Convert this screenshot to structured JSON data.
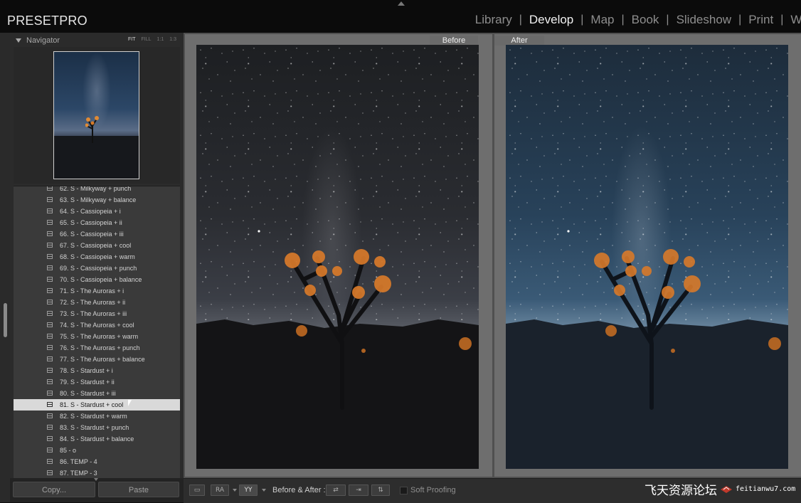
{
  "app": {
    "brand": "PRESETPRO"
  },
  "modules": [
    "Library",
    "Develop",
    "Map",
    "Book",
    "Slideshow",
    "Print",
    "Web"
  ],
  "active_module": "Develop",
  "navigator": {
    "title": "Navigator",
    "zoom_options": [
      "FIT",
      "FILL",
      "1:1",
      "1:3"
    ],
    "active_zoom": "FIT"
  },
  "presets": [
    "62. S - Milkyway + punch",
    "63. S - Milkyway + balance",
    "64. S - Cassiopeia + i",
    "65. S - Cassiopeia + ii",
    "66. S - Cassiopeia + iii",
    "67. S - Cassiopeia + cool",
    "68. S - Cassiopeia + warm",
    "69. S - Cassiopeia + punch",
    "70. S - Cassiopeia + balance",
    "71. S - The Auroras + i",
    "72. S - The Auroras + ii",
    "73. S - The Auroras + iii",
    "74. S - The Auroras + cool",
    "75. S - The Auroras + warm",
    "76. S - The Auroras + punch",
    "77. S - The Auroras + balance",
    "78. S - Stardust + i",
    "79. S - Stardust + ii",
    "80. S - Stardust + iii",
    "81. S - Stardust + cool",
    "82. S - Stardust + warm",
    "83. S - Stardust + punch",
    "84. S - Stardust + balance",
    "85 - o",
    "86. TEMP - 4",
    "87. TEMP - 3"
  ],
  "selected_preset": "81. S - Stardust + cool",
  "left_buttons": {
    "copy": "Copy...",
    "paste": "Paste"
  },
  "compare": {
    "before_label": "Before",
    "after_label": "After"
  },
  "toolbar": {
    "view_buttons": [
      "loupe",
      "before-after-left-right",
      "before-after-split"
    ],
    "before_after_label": "Before & After :",
    "soft_proofing_label": "Soft Proofing",
    "soft_proofing_checked": false
  },
  "watermark": {
    "cn": "飞天资源论坛",
    "en": "feitianwu7.com"
  },
  "colors": {
    "accent_selected": "#d9d9d9",
    "panel_bg": "#2b2b2b",
    "center_bg": "#505050"
  }
}
